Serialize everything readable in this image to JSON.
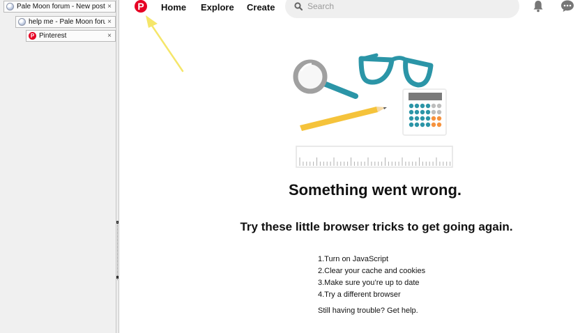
{
  "sidebar": {
    "tabs": [
      {
        "label": "Pale Moon forum - New posts",
        "icon": "globe-icon",
        "close": "×"
      },
      {
        "label": "help me - Pale Moon forum",
        "icon": "globe-icon",
        "close": "×"
      },
      {
        "label": "Pinterest",
        "icon": "pinterest-icon",
        "close": "×"
      }
    ]
  },
  "header": {
    "logo": "P",
    "nav": [
      "Home",
      "Explore",
      "Create"
    ],
    "search_placeholder": "Search"
  },
  "main": {
    "headline": "Something went wrong.",
    "subhead": "Try these little browser tricks to get going again.",
    "tips": [
      "1.Turn on JavaScript",
      "2.Clear your cache and cookies",
      "3.Make sure you’re up to date",
      "4.Try a different browser"
    ],
    "trouble": "Still having trouble? Get help."
  },
  "colors": {
    "brand": "#e60023",
    "teal": "#2b95a7",
    "yellow": "#f5c33b",
    "orange": "#f5923e",
    "annotation_arrow": "#f5e66a"
  }
}
